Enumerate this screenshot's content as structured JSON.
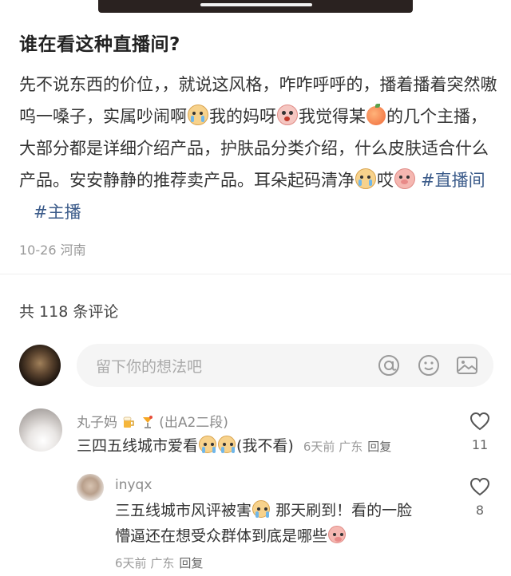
{
  "post": {
    "title": "谁在看这种直播间?",
    "body_segments": [
      "先不说东西的价位，，就说这风格，咋咋呼呼的，播着播着突然嗷呜一嗓子，实属吵闹啊",
      "我的妈呀",
      "我觉得某",
      "的几个主播，大部分都是详细介绍产品，护肤品分类介绍，什么皮肤适合什么产品。安安静静的推荐卖产品。耳朵起码清净",
      "哎"
    ],
    "hashtags": [
      "#直播间",
      "#主播"
    ],
    "date": "10-26",
    "location": "河南"
  },
  "comments_header": {
    "text": "共 118 条评论"
  },
  "comment_input": {
    "placeholder": "留下你的想法吧"
  },
  "comments": [
    {
      "name_prefix": "丸子妈",
      "name_suffix": "(出A2二段)",
      "text_a": "三四五线城市爱看",
      "text_b": "(我不看)",
      "time": "6天前",
      "location": "广东",
      "reply_label": "回复",
      "likes": "11"
    },
    {
      "name": "inyqx",
      "line1_a": "三五线城市风评被害",
      "line1_b": "那天刷到！看的一脸",
      "line2": "懵逼还在想受众群体到底是哪些",
      "time": "6天前",
      "location": "广东",
      "reply_label": "回复",
      "likes": "8"
    }
  ],
  "icons": [
    "at-icon",
    "emoji-icon",
    "image-icon",
    "heart-icon",
    "drink-icon"
  ],
  "colors": {
    "hashtag": "#3b5b8a",
    "meta": "#999999",
    "input_bg": "#f5f5f5"
  }
}
